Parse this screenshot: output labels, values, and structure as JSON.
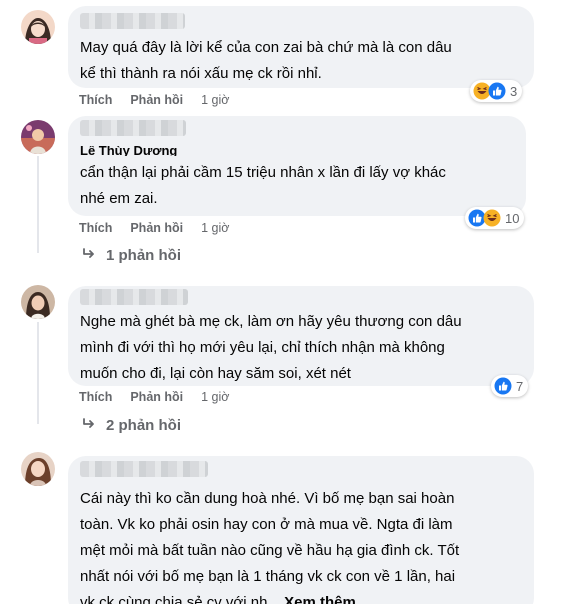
{
  "comments": [
    {
      "author": "",
      "lines": [
        "May quá đây là lời kể của con zai bà chứ mà là con dâu",
        "kể thì thành ra nói xấu mẹ ck rồi nhỉ."
      ],
      "like_label": "Thích",
      "reply_label": "Phản hồi",
      "time": "1 giờ",
      "reactions": [
        "haha-icon",
        "like-icon"
      ],
      "reaction_count": "3"
    },
    {
      "author": "Lê Thùy Dương",
      "lines": [
        "cẩn thận lại phải cầm 15 triệu nhân x lần đi lấy vợ khác",
        "nhé em zai."
      ],
      "like_label": "Thích",
      "reply_label": "Phản hồi",
      "time": "1 giờ",
      "reactions": [
        "like-icon",
        "haha-icon"
      ],
      "reaction_count": "10",
      "replies_label": "1 phản hồi"
    },
    {
      "author": "",
      "lines": [
        "Nghe mà ghét bà mẹ ck, làm ơn hãy yêu thương con dâu",
        "mình đi với thì họ mới yêu lại, chỉ thích nhận mà không",
        "muốn cho đi, lại còn hay săm soi, xét nét"
      ],
      "like_label": "Thích",
      "reply_label": "Phản hồi",
      "time": "1 giờ",
      "reactions": [
        "like-icon"
      ],
      "reaction_count": "7",
      "replies_label": "2 phản hồi"
    },
    {
      "author": "",
      "lines": [
        "Cái này thì ko cần dung hoà nhé. Vì bố mẹ bạn sai hoàn",
        "toàn. Vk ko phải osin hay con ở mà mua về. Ngta đi làm",
        "mệt mỏi mà bất tuần nào cũng về hầu hạ gia đình ck. Tốt",
        "nhất nói với bố mẹ bạn là 1 tháng vk ck con về 1 lần, hai",
        "vk ck cùng chia sẻ cv với nh..."
      ],
      "see_more": "Xem thêm"
    }
  ],
  "colors": {
    "bubble": "#f0f2f5",
    "meta": "#65676b",
    "like_blue": "#1877f2",
    "haha_yellow": "#f7b125"
  }
}
